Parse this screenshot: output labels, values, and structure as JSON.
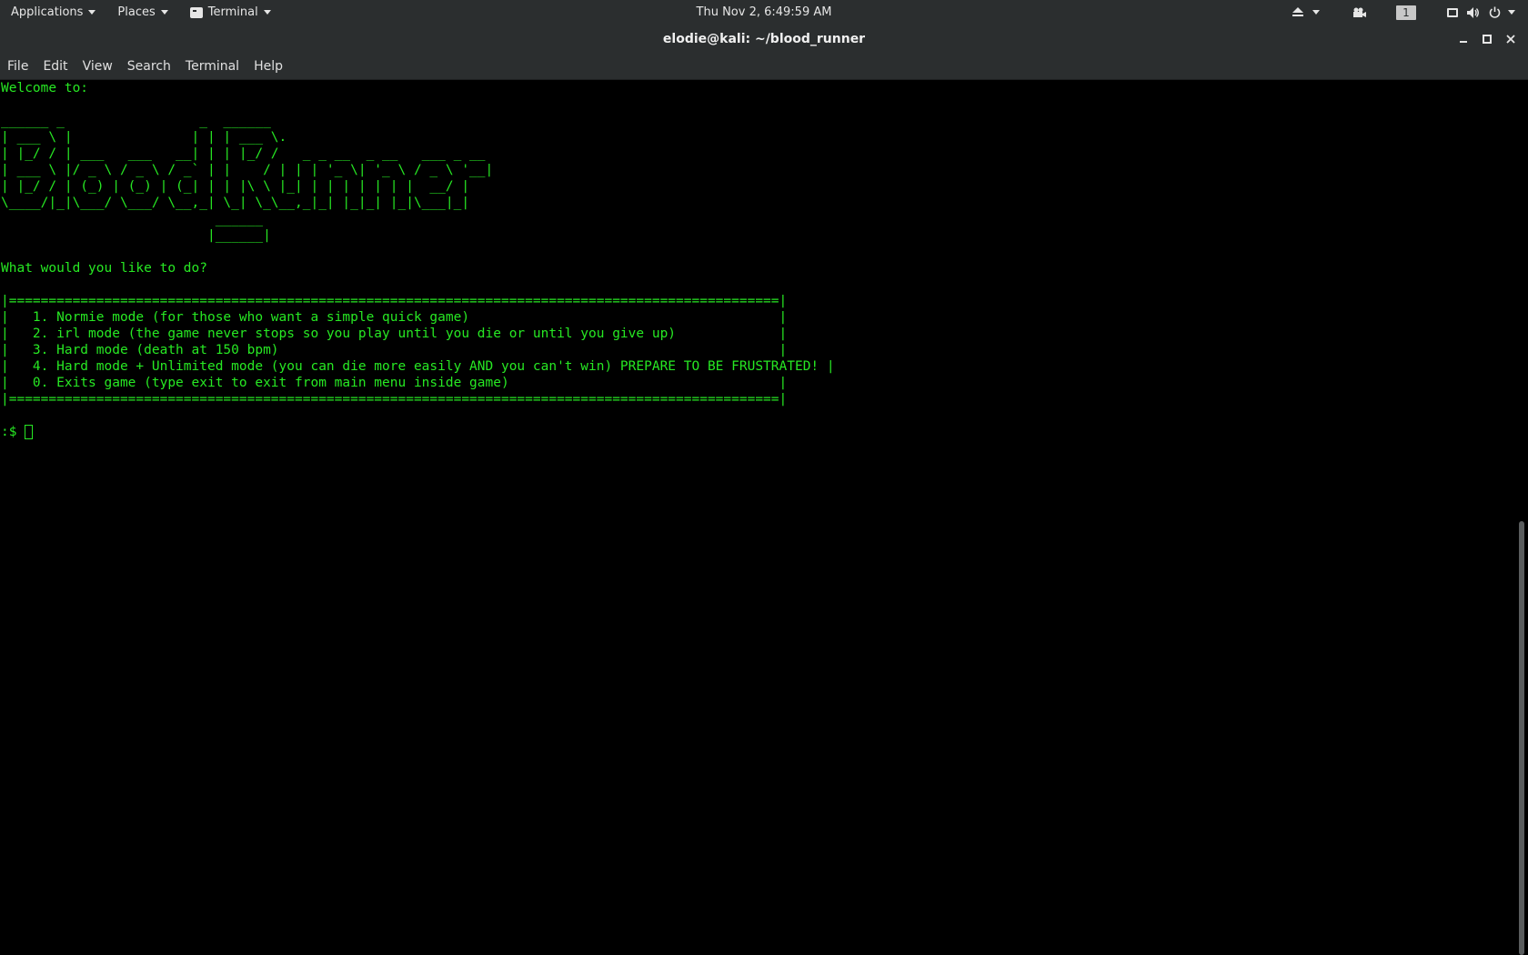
{
  "topbar": {
    "applications_label": "Applications",
    "places_label": "Places",
    "terminal_label": "Terminal",
    "clock": "Thu Nov  2,  6:49:59 AM",
    "workspace_number": "1"
  },
  "window": {
    "title": "elodie@kali: ~/blood_runner"
  },
  "menubar": {
    "file": "File",
    "edit": "Edit",
    "view": "View",
    "search": "Search",
    "terminal": "Terminal",
    "help": "Help"
  },
  "terminal": {
    "welcome": "Welcome to:",
    "banner": [
      "______ _                 _  ______",
      "| ___ \\ |               | | | ___ \\.",
      "| |_/ / | ___   ___   __| | | |_/ /   _ _ __  _ __   ___ _ __",
      "| ___ \\ |/ _ \\ / _ \\ / _` | |    / | | | '_ \\| '_ \\ / _ \\ '__|",
      "| |_/ / | (_) | (_) | (_| | | |\\ \\ |_| | | | | | | |  __/ |",
      "\\____/|_|\\___/ \\___/ \\__,_| \\_| \\_\\__,_|_| |_|_| |_|\\___|_|",
      "                           ______",
      "                          |______|"
    ],
    "question": "What would you like to do?",
    "menu_border": "|=================================================================================================|",
    "options": [
      "|   1. Normie mode (for those who want a simple quick game)                                       |",
      "|   2. irl mode (the game never stops so you play until you die or until you give up)             |",
      "|   3. Hard mode (death at 150 bpm)                                                               |",
      "|   4. Hard mode + Unlimited mode (you can die more easily AND you can't win) PREPARE TO BE FRUSTRATED! |",
      "|   0. Exits game (type exit to exit from main menu inside game)                                  |"
    ],
    "prompt": ":$"
  },
  "colors": {
    "terminal_fg": "#27e823",
    "terminal_bg": "#000000",
    "chrome_bg": "#2b2e2f"
  }
}
